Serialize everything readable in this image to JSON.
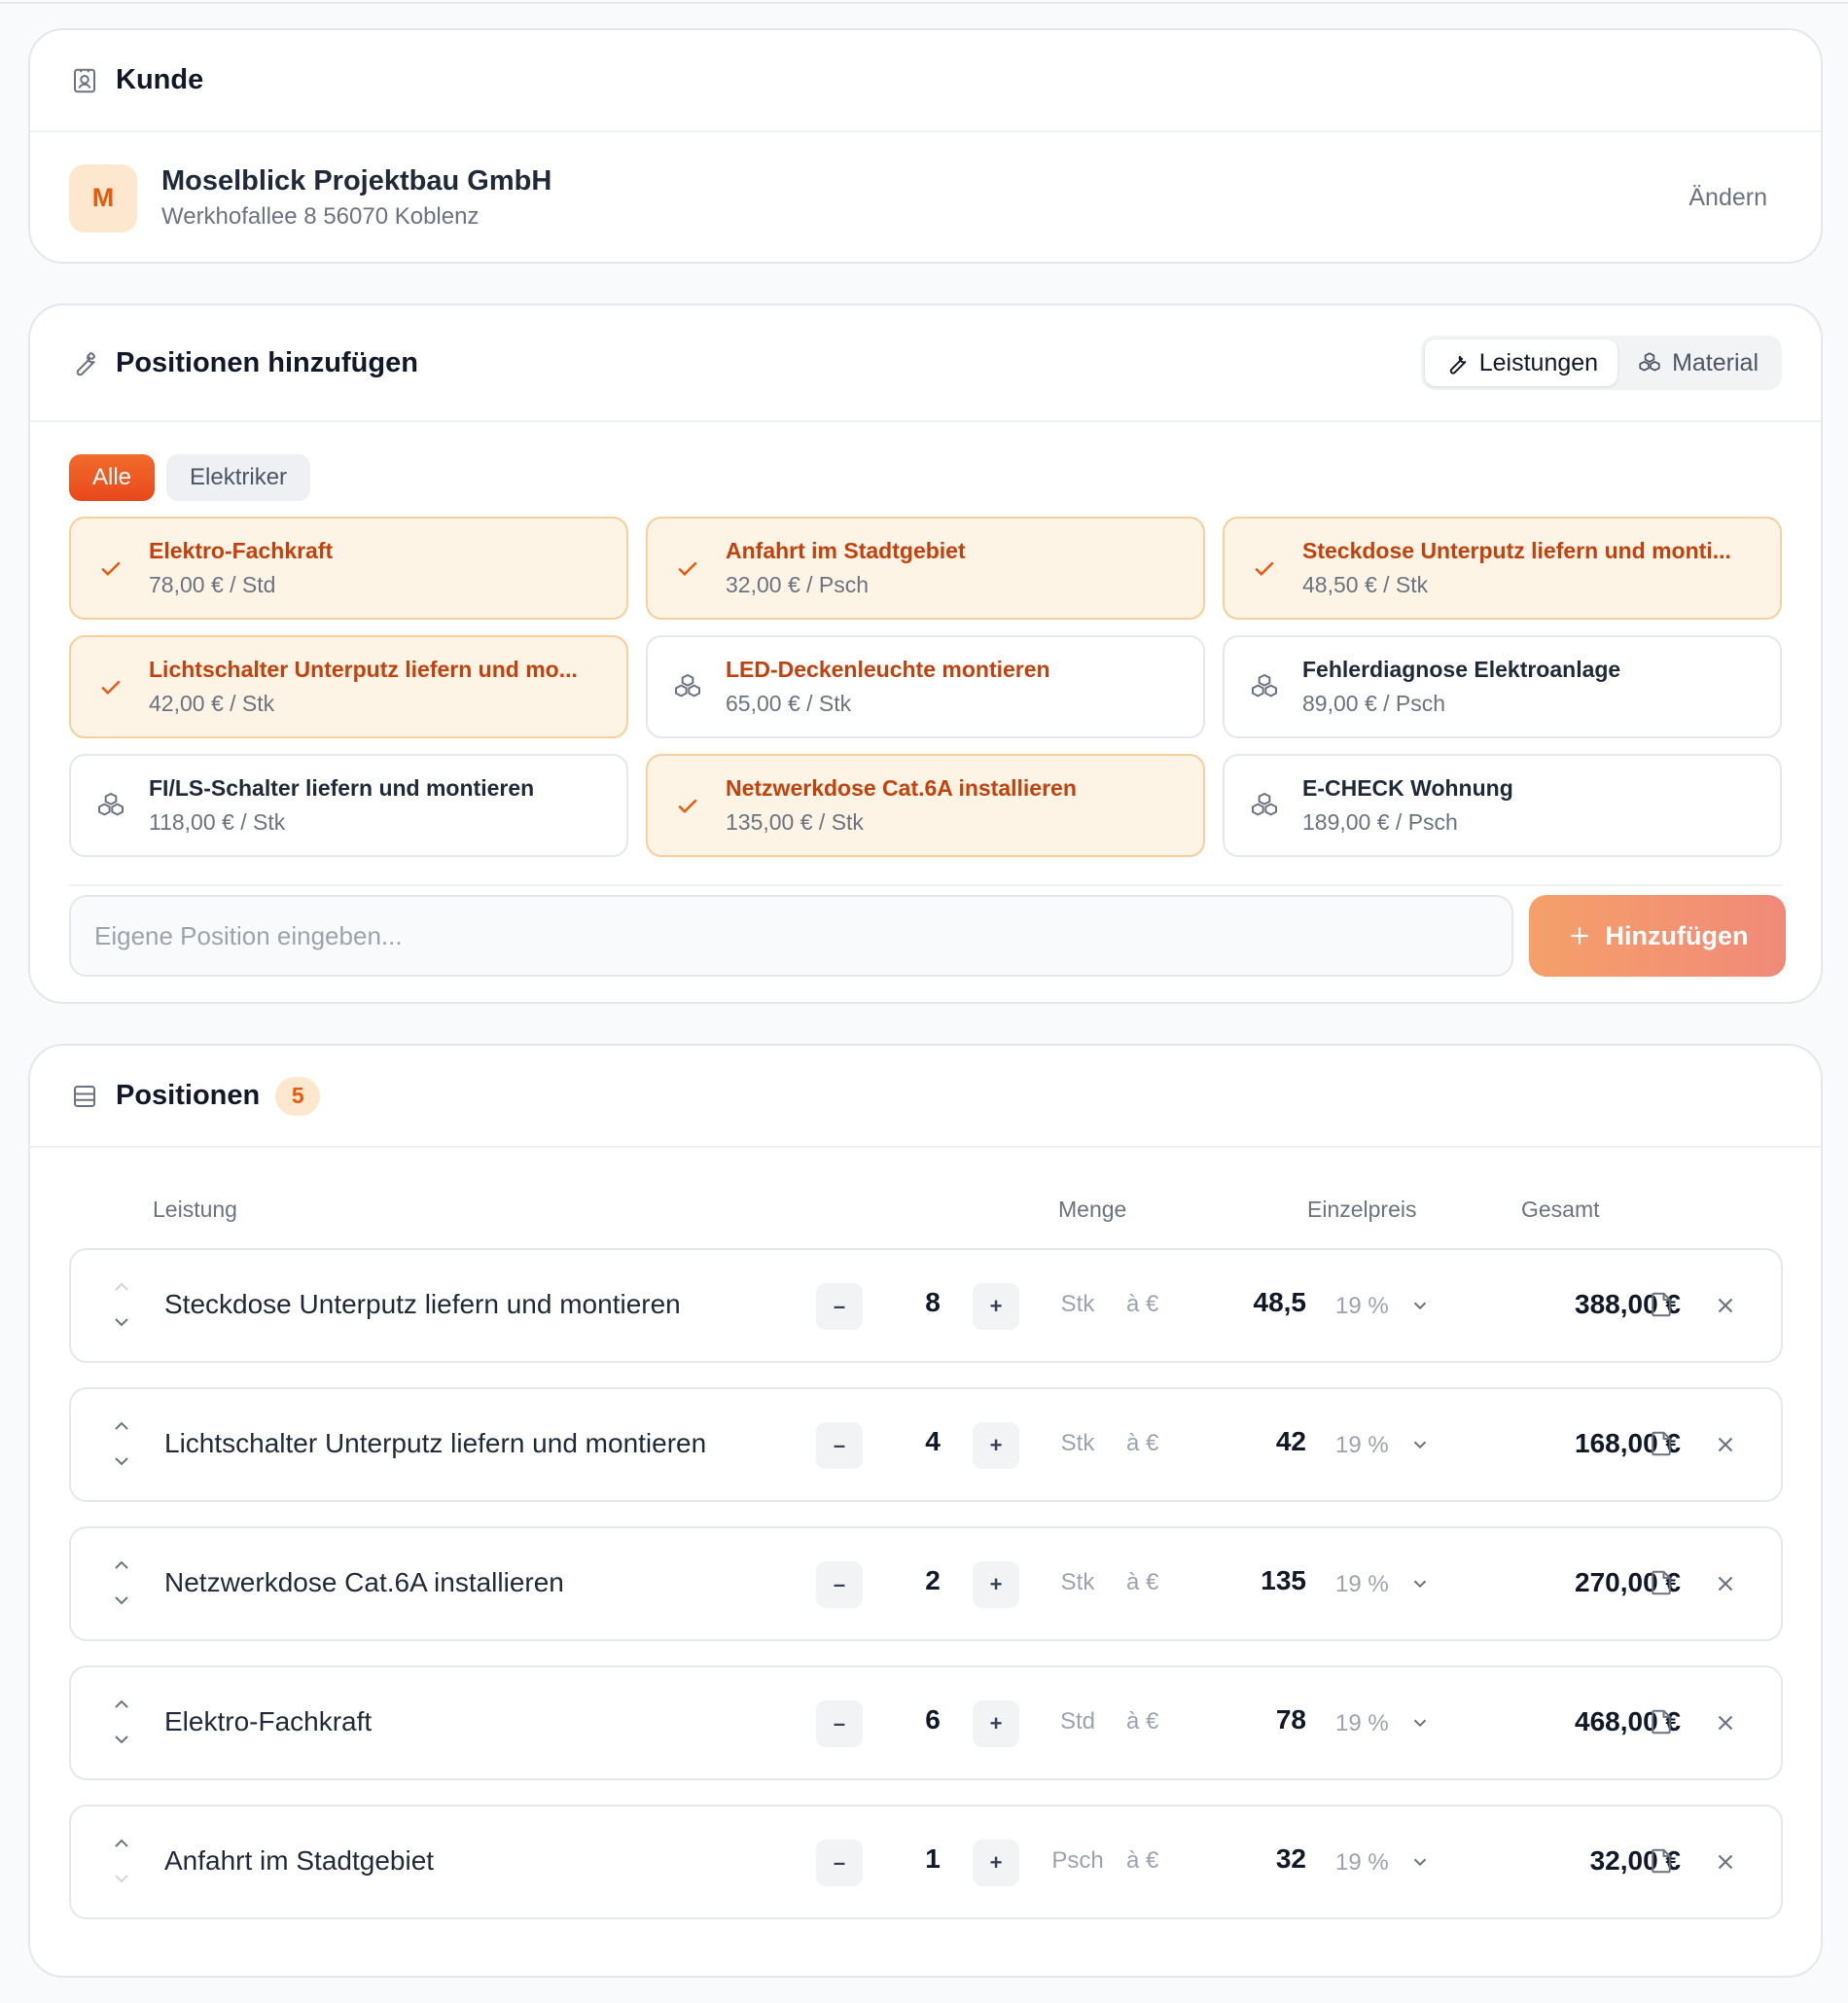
{
  "customer_section": {
    "title": "Kunde",
    "avatar_letter": "M",
    "name": "Moselblick Projektbau GmbH",
    "address": "Werkhofallee 8 56070 Koblenz",
    "change_label": "Ändern"
  },
  "add_section": {
    "title": "Positionen hinzufügen",
    "toggle": {
      "services_label": "Leistungen",
      "material_label": "Material",
      "active": "Leistungen"
    },
    "filters": [
      {
        "label": "Alle",
        "active": true
      },
      {
        "label": "Elektriker",
        "active": false
      }
    ],
    "tiles": [
      {
        "name": "Elektro-Fachkraft",
        "price": "78,00 € / Std",
        "selected": true
      },
      {
        "name": "Anfahrt im Stadtgebiet",
        "price": "32,00 € / Psch",
        "selected": true
      },
      {
        "name": "Steckdose Unterputz liefern und monti...",
        "price": "48,50 € / Stk",
        "selected": true
      },
      {
        "name": "Lichtschalter Unterputz liefern und mo...",
        "price": "42,00 € / Stk",
        "selected": true
      },
      {
        "name": "LED-Deckenleuchte montieren",
        "price": "65,00 € / Stk",
        "selected": false
      },
      {
        "name": "Fehlerdiagnose Elektroanlage",
        "price": "89,00 € / Psch",
        "selected": false
      },
      {
        "name": "FI/LS-Schalter liefern und montieren",
        "price": "118,00 € / Stk",
        "selected": false
      },
      {
        "name": "Netzwerkdose Cat.6A installieren",
        "price": "135,00 € / Stk",
        "selected": true
      },
      {
        "name": "E-CHECK Wohnung",
        "price": "189,00 € / Psch",
        "selected": false
      }
    ],
    "custom_input": {
      "placeholder": "Eigene Position eingeben...",
      "value": ""
    },
    "add_button_label": "Hinzufügen"
  },
  "positions_section": {
    "title": "Positionen",
    "count": "5",
    "columns": {
      "service": "Leistung",
      "quantity": "Menge",
      "unit_price": "Einzelpreis",
      "total": "Gesamt"
    },
    "rows": [
      {
        "name": "Steckdose Unterputz liefern und montieren",
        "qty": "8",
        "unit": "Stk",
        "a_eur": "à €",
        "price": "48,5",
        "vat": "19 %",
        "total": "388,00 €",
        "up_disabled": true,
        "down_disabled": false
      },
      {
        "name": "Lichtschalter Unterputz liefern und montieren",
        "qty": "4",
        "unit": "Stk",
        "a_eur": "à €",
        "price": "42",
        "vat": "19 %",
        "total": "168,00 €",
        "up_disabled": false,
        "down_disabled": false
      },
      {
        "name": "Netzwerkdose Cat.6A installieren",
        "qty": "2",
        "unit": "Stk",
        "a_eur": "à €",
        "price": "135",
        "vat": "19 %",
        "total": "270,00 €",
        "up_disabled": false,
        "down_disabled": false
      },
      {
        "name": "Elektro-Fachkraft",
        "qty": "6",
        "unit": "Std",
        "a_eur": "à €",
        "price": "78",
        "vat": "19 %",
        "total": "468,00 €",
        "up_disabled": false,
        "down_disabled": false
      },
      {
        "name": "Anfahrt im Stadtgebiet",
        "qty": "1",
        "unit": "Psch",
        "a_eur": "à €",
        "price": "32",
        "vat": "19 %",
        "total": "32,00 €",
        "up_disabled": false,
        "down_disabled": true
      }
    ],
    "minus_label": "–",
    "plus_label": "+"
  },
  "colors": {
    "accent": "#ea580c",
    "selected_bg": "#fef4e6",
    "selected_border": "#f6cf9a"
  }
}
